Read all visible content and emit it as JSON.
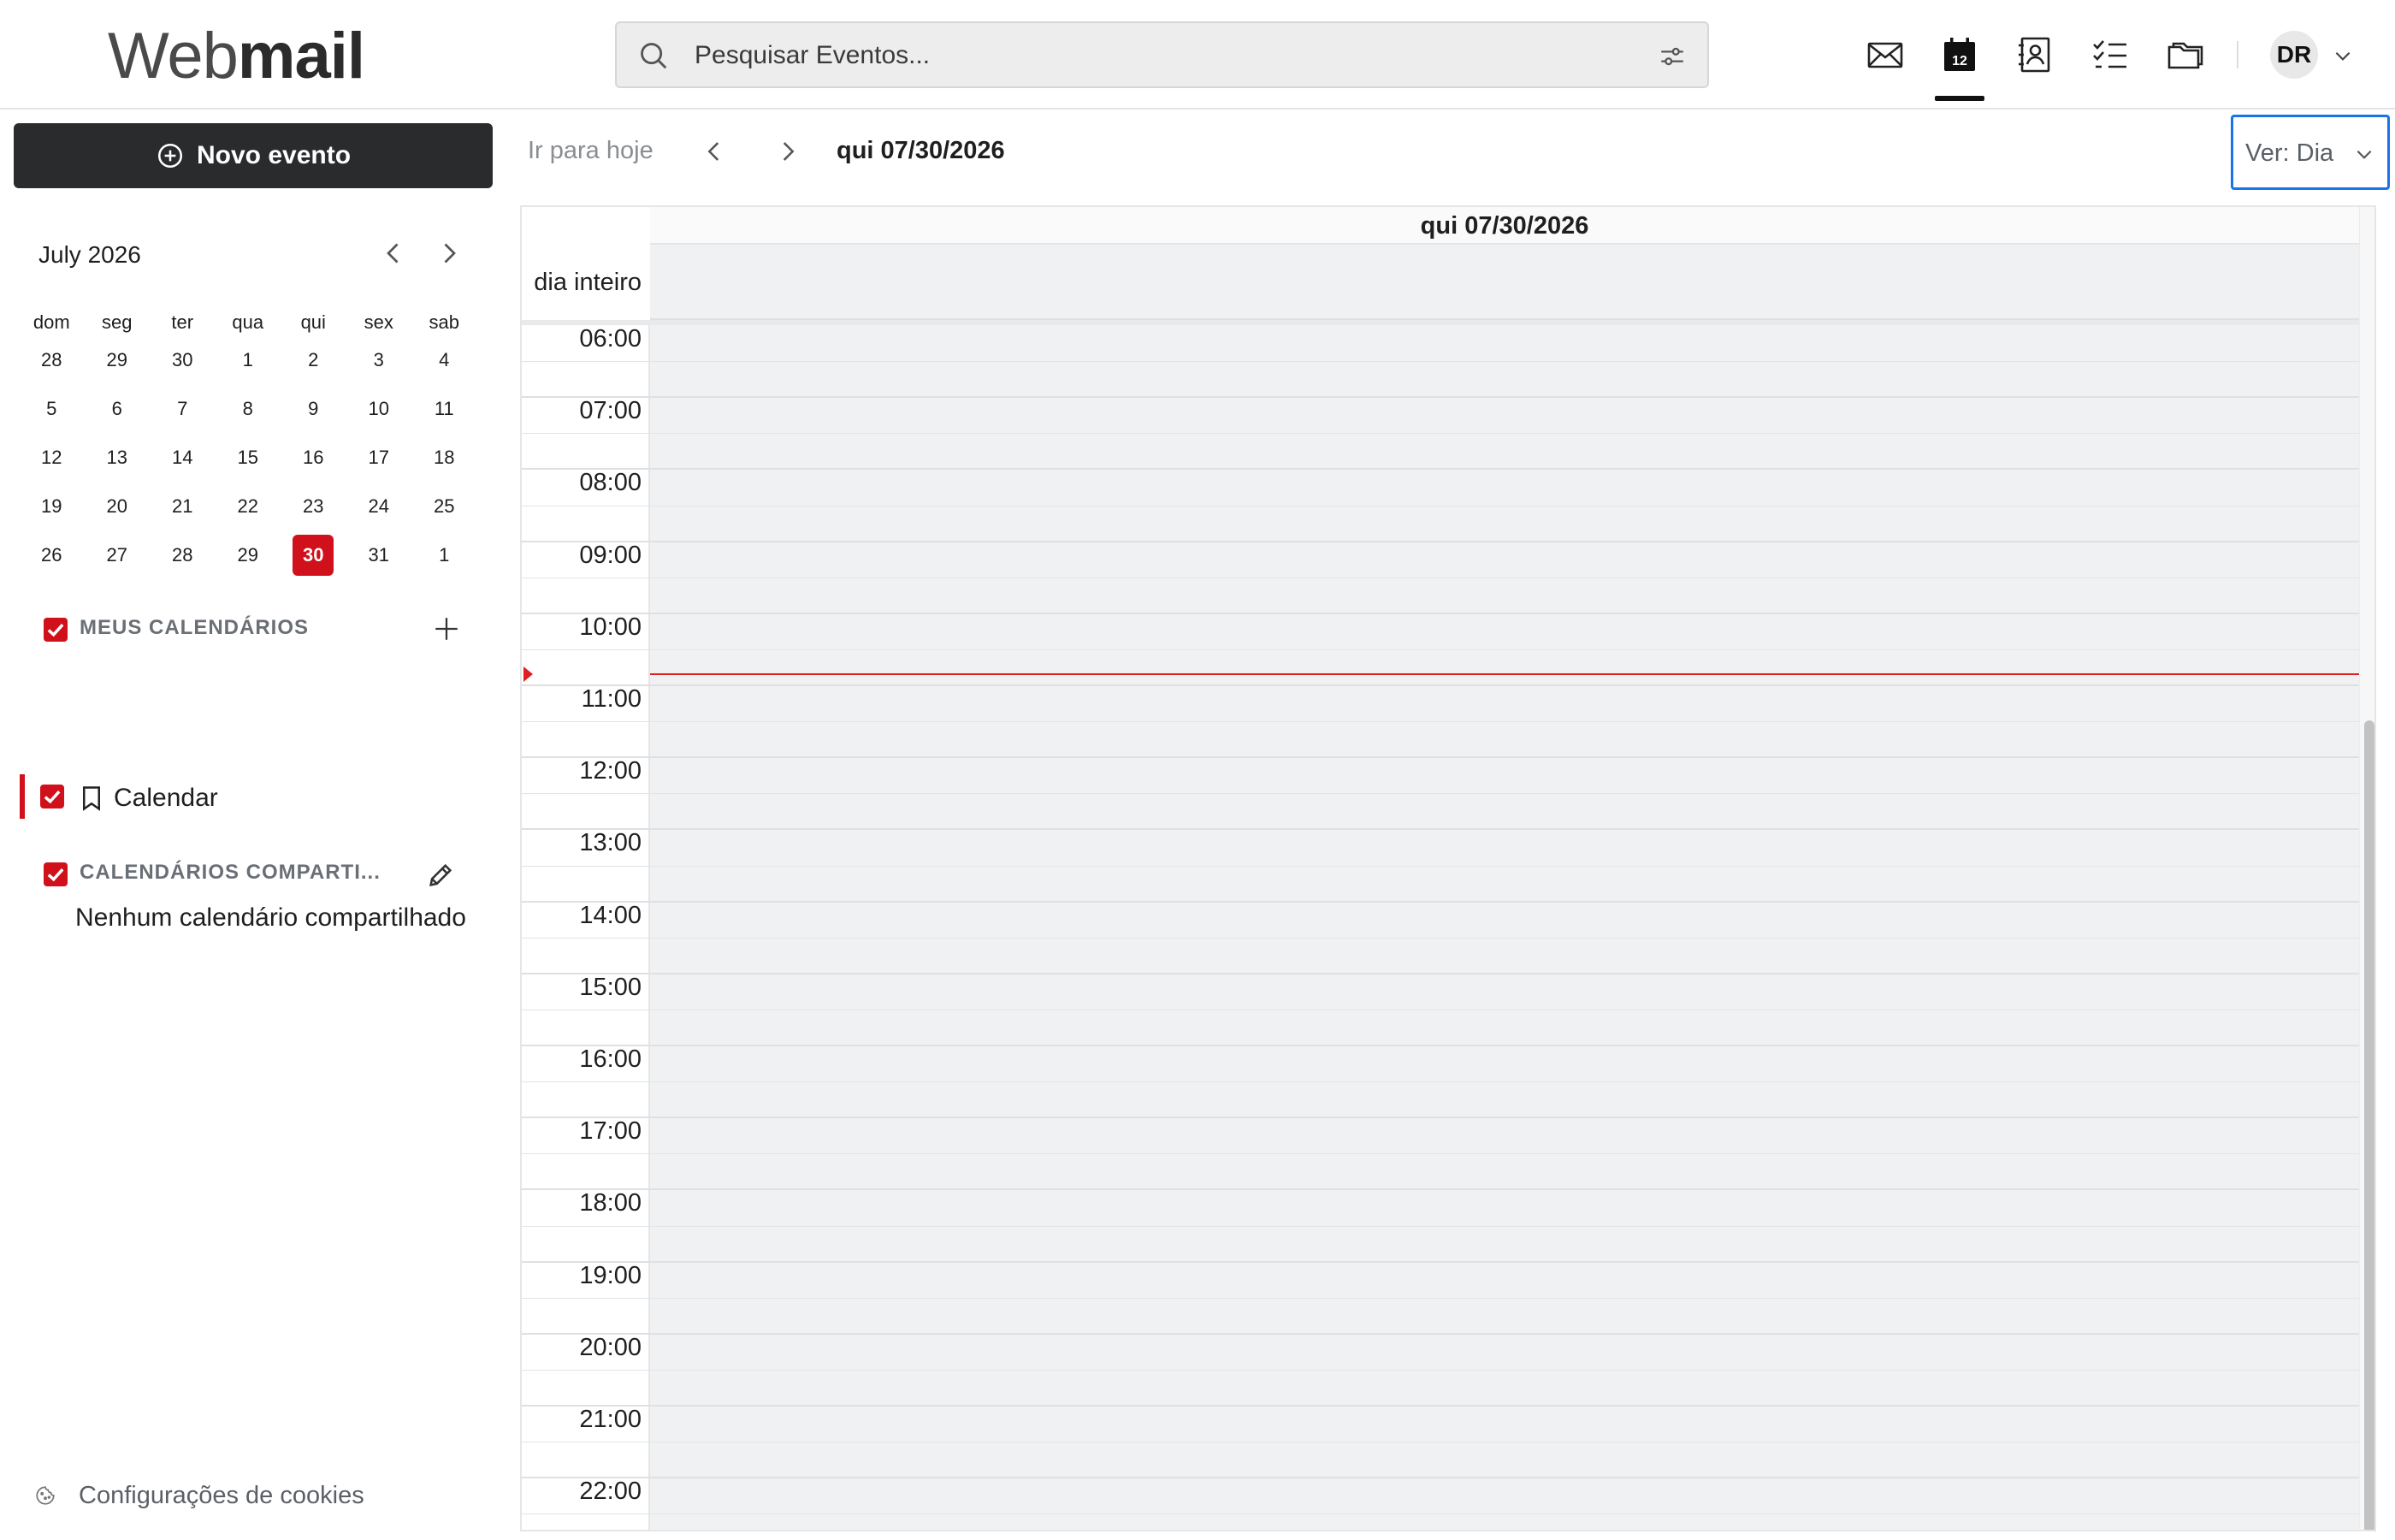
{
  "header": {
    "logo_light": "Web",
    "logo_bold": "mail",
    "search_placeholder": "Pesquisar Eventos...",
    "avatar_initials": "DR",
    "apps": [
      "mail-icon",
      "calendar-icon",
      "contacts-icon",
      "tasks-icon",
      "files-icon"
    ],
    "calendar_icon_day": "12"
  },
  "sidebar": {
    "new_event_label": "Novo evento",
    "mini_calendar": {
      "title": "July 2026",
      "weekdays": [
        "dom",
        "seg",
        "ter",
        "qua",
        "qui",
        "sex",
        "sab"
      ],
      "weeks": [
        [
          "28",
          "29",
          "30",
          "1",
          "2",
          "3",
          "4"
        ],
        [
          "5",
          "6",
          "7",
          "8",
          "9",
          "10",
          "11"
        ],
        [
          "12",
          "13",
          "14",
          "15",
          "16",
          "17",
          "18"
        ],
        [
          "19",
          "20",
          "21",
          "22",
          "23",
          "24",
          "25"
        ],
        [
          "26",
          "27",
          "28",
          "29",
          "30",
          "31",
          "1"
        ]
      ],
      "today": "30"
    },
    "my_calendars_label": "MEUS CALENDÁRIOS",
    "calendar_item": "Calendar",
    "shared_calendars_label": "CALENDÁRIOS COMPARTI...",
    "no_shared": "Nenhum calendário compartilhado",
    "cookies_label": "Configurações de cookies"
  },
  "main": {
    "goto_today": "Ir para hoje",
    "current_date": "qui 07/30/2026",
    "view_label": "Ver: Dia",
    "day_header": "qui 07/30/2026",
    "all_day_label": "dia inteiro",
    "hours": [
      "06:00",
      "07:00",
      "08:00",
      "09:00",
      "10:00",
      "11:00",
      "12:00",
      "13:00",
      "14:00",
      "15:00",
      "16:00",
      "17:00",
      "18:00",
      "19:00",
      "20:00",
      "21:00",
      "22:00"
    ]
  },
  "colors": {
    "accent_red": "#d0101a",
    "focus_blue": "#1a73e8",
    "now_line": "#e02020"
  }
}
